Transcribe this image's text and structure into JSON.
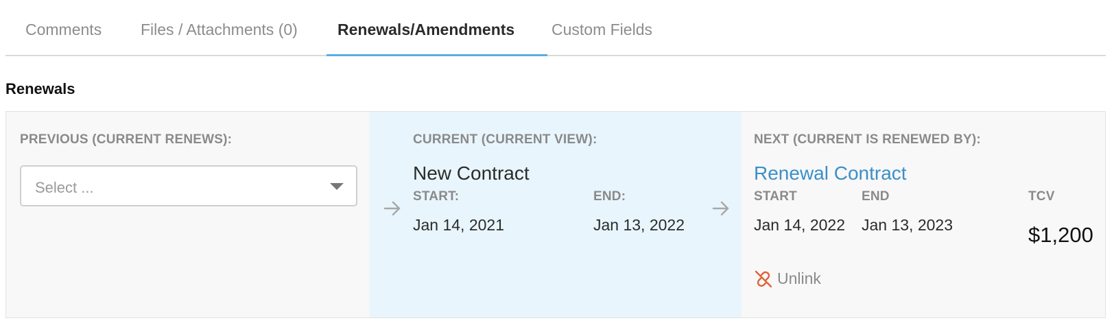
{
  "tabs": [
    {
      "label": "Comments"
    },
    {
      "label": "Files / Attachments (0)"
    },
    {
      "label": "Renewals/Amendments"
    },
    {
      "label": "Custom Fields"
    }
  ],
  "active_tab": "Renewals/Amendments",
  "section_title": "Renewals",
  "previous": {
    "label": "PREVIOUS (CURRENT RENEWS):",
    "select_placeholder": "Select ..."
  },
  "current": {
    "label": "CURRENT (CURRENT VIEW):",
    "title": "New Contract",
    "start_label": "START:",
    "end_label": "END:",
    "start": "Jan 14, 2021",
    "end": "Jan 13, 2022"
  },
  "next": {
    "label": "NEXT (CURRENT IS RENEWED BY):",
    "title": "Renewal Contract",
    "start_label": "START",
    "end_label": "END",
    "tcv_label": "TCV",
    "start": "Jan 14, 2022",
    "end": "Jan 13, 2023",
    "tcv": "$1,200",
    "unlink_label": "Unlink"
  },
  "colors": {
    "accent": "#5aaee0",
    "link": "#3a8fc8",
    "unlink_icon": "#e0613a",
    "current_bg": "#e8f5fd"
  },
  "icons": {
    "arrow": "arrow-right-icon",
    "caret": "chevron-down-icon",
    "unlink": "unlink-icon"
  }
}
